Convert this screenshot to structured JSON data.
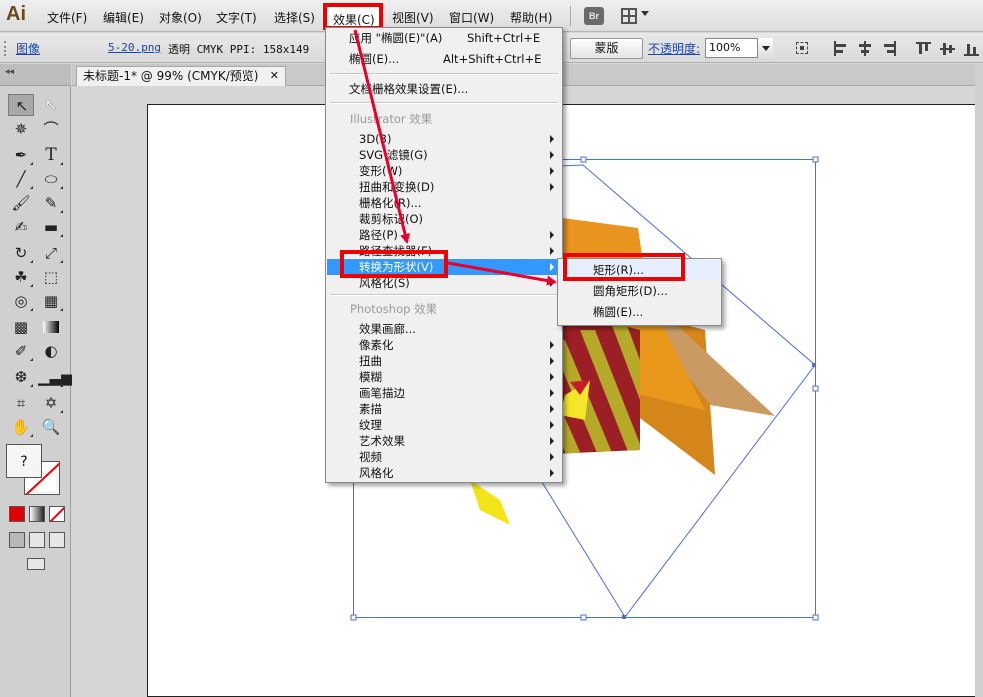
{
  "app": {
    "logo": "Ai"
  },
  "menubar": {
    "items": [
      "文件(F)",
      "编辑(E)",
      "对象(O)",
      "文字(T)",
      "选择(S)",
      "效果(C)",
      "视图(V)",
      "窗口(W)",
      "帮助(H)"
    ],
    "bridge_label": "Br"
  },
  "controlbar": {
    "type": "图像",
    "filename": "5-20.png",
    "info": "透明 CMYK  PPI: 158x149",
    "mask_button": "蒙版",
    "opacity_label": "不透明度:",
    "opacity_value": "100%"
  },
  "document": {
    "tab_title": "未标题-1* @ 99% (CMYK/预览)",
    "close": "✕"
  },
  "toolbar": {
    "fill_label": "?"
  },
  "effect_menu": {
    "apply_last": {
      "label": "应用 \"椭圆(E)\"(A)",
      "shortcut": "Shift+Ctrl+E"
    },
    "last_effect": {
      "label": "椭圆(E)...",
      "shortcut": "Alt+Shift+Ctrl+E"
    },
    "raster_settings": "文档栅格效果设置(E)...",
    "illustrator_header": "Illustrator 效果",
    "illustrator_items": [
      "3D(3)",
      "SVG 滤镜(G)",
      "变形(W)",
      "扭曲和变换(D)",
      "栅格化(R)...",
      "裁剪标记(O)",
      "路径(P)",
      "路径查找器(F)",
      "转换为形状(V)",
      "风格化(S)"
    ],
    "photoshop_header": "Photoshop 效果",
    "photoshop_items": [
      "效果画廊...",
      "像素化",
      "扭曲",
      "模糊",
      "画笔描边",
      "素描",
      "纹理",
      "艺术效果",
      "视频",
      "风格化"
    ]
  },
  "submenu": {
    "items": [
      "矩形(R)...",
      "圆角矩形(D)...",
      "椭圆(E)..."
    ]
  },
  "colors": {
    "highlight": "#3399ff",
    "annotation": "#ee0000",
    "selection": "#4a6fd8"
  }
}
